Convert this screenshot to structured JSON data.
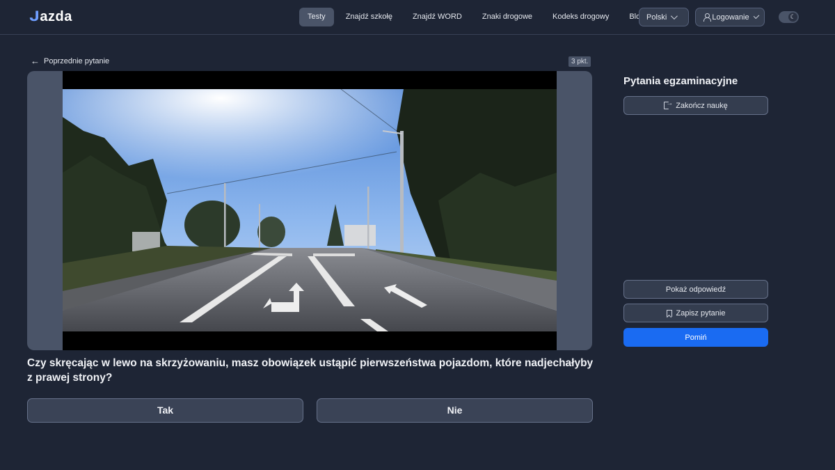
{
  "header": {
    "logo_text": "Jazda",
    "nav": [
      {
        "label": "Testy",
        "active": true
      },
      {
        "label": "Znajdź szkołę",
        "active": false
      },
      {
        "label": "Znajdź WORD",
        "active": false
      },
      {
        "label": "Znaki drogowe",
        "active": false
      },
      {
        "label": "Kodeks drogowy",
        "active": false
      },
      {
        "label": "Blog",
        "active": false
      }
    ],
    "language": "Polski",
    "login": "Logowanie",
    "theme_icon": "moon-icon"
  },
  "main": {
    "back_label": "Poprzednie pytanie",
    "points": "3 pkt.",
    "question": "Czy skręcając w lewo na skrzyżowaniu, masz obowiązek ustąpić pierwszeństwa pojazdom, które nadjechałyby z prawej strony?",
    "answers": {
      "yes": "Tak",
      "no": "Nie"
    }
  },
  "sidebar": {
    "title": "Pytania egzaminacyjne",
    "end_label": "Zakończ naukę",
    "show_answer_label": "Pokaż odpowiedź",
    "save_label": "Zapisz pytanie",
    "skip_label": "Pomiń"
  },
  "colors": {
    "background": "#1e2535",
    "primary": "#1a6bf2",
    "accent_logo": "#6e9dff"
  }
}
